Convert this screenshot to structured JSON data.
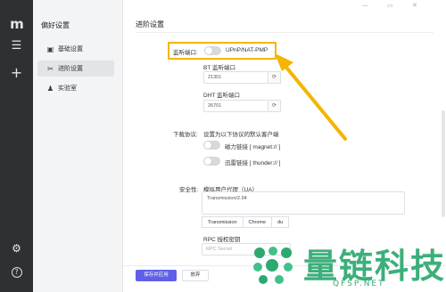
{
  "rail": {
    "logo": "m",
    "icons": [
      "menu-icon",
      "plus-icon",
      "sliders-icon",
      "help-icon"
    ],
    "menu_glyph": "☰",
    "plus_glyph": "+",
    "sliders_glyph": "⚙",
    "help_glyph": "?"
  },
  "sidebar": {
    "title": "偏好设置",
    "items": [
      {
        "label": "基础设置",
        "icon": "switch-icon",
        "glyph": "▣"
      },
      {
        "label": "进阶设置",
        "icon": "tools-icon",
        "glyph": "✂"
      },
      {
        "label": "实验室",
        "icon": "lab-icon",
        "glyph": "♟"
      }
    ]
  },
  "window": {
    "minimize": "—",
    "maximize": "▭",
    "close": "✕"
  },
  "section": {
    "title": "进阶设置"
  },
  "listen_port": {
    "label": "监听端口:",
    "toggle_label": "UPnP/NAT-PMP",
    "bt_label": "BT 监听端口",
    "bt_value": "21301",
    "dht_label": "DHT 监听端口",
    "dht_value": "26701",
    "refresh_glyph": "⟳"
  },
  "protocol": {
    "label": "下载协议:",
    "description": "设置为以下协议的默认客户端",
    "magnet_label": "磁力链接 [ magnet:// ]",
    "thunder_label": "迅雷链接 [ thunder:// ]"
  },
  "security": {
    "label": "安全性:",
    "ua_label": "模拟用户代理（UA）",
    "ua_value": "Transmission/2.94",
    "chips": [
      "Transmission",
      "Chrome",
      "du"
    ],
    "rpc_label": "RPC 授权密钥",
    "rpc_placeholder": "RPC Secret"
  },
  "footer": {
    "save_label": "保存并应用",
    "discard_label": "放弃"
  },
  "watermark": {
    "text": "量链科技",
    "url": "QFSP.NET"
  },
  "colors": {
    "highlight": "#f5b400",
    "primary": "#5f5fe8",
    "watermark": "#2ca96f"
  }
}
